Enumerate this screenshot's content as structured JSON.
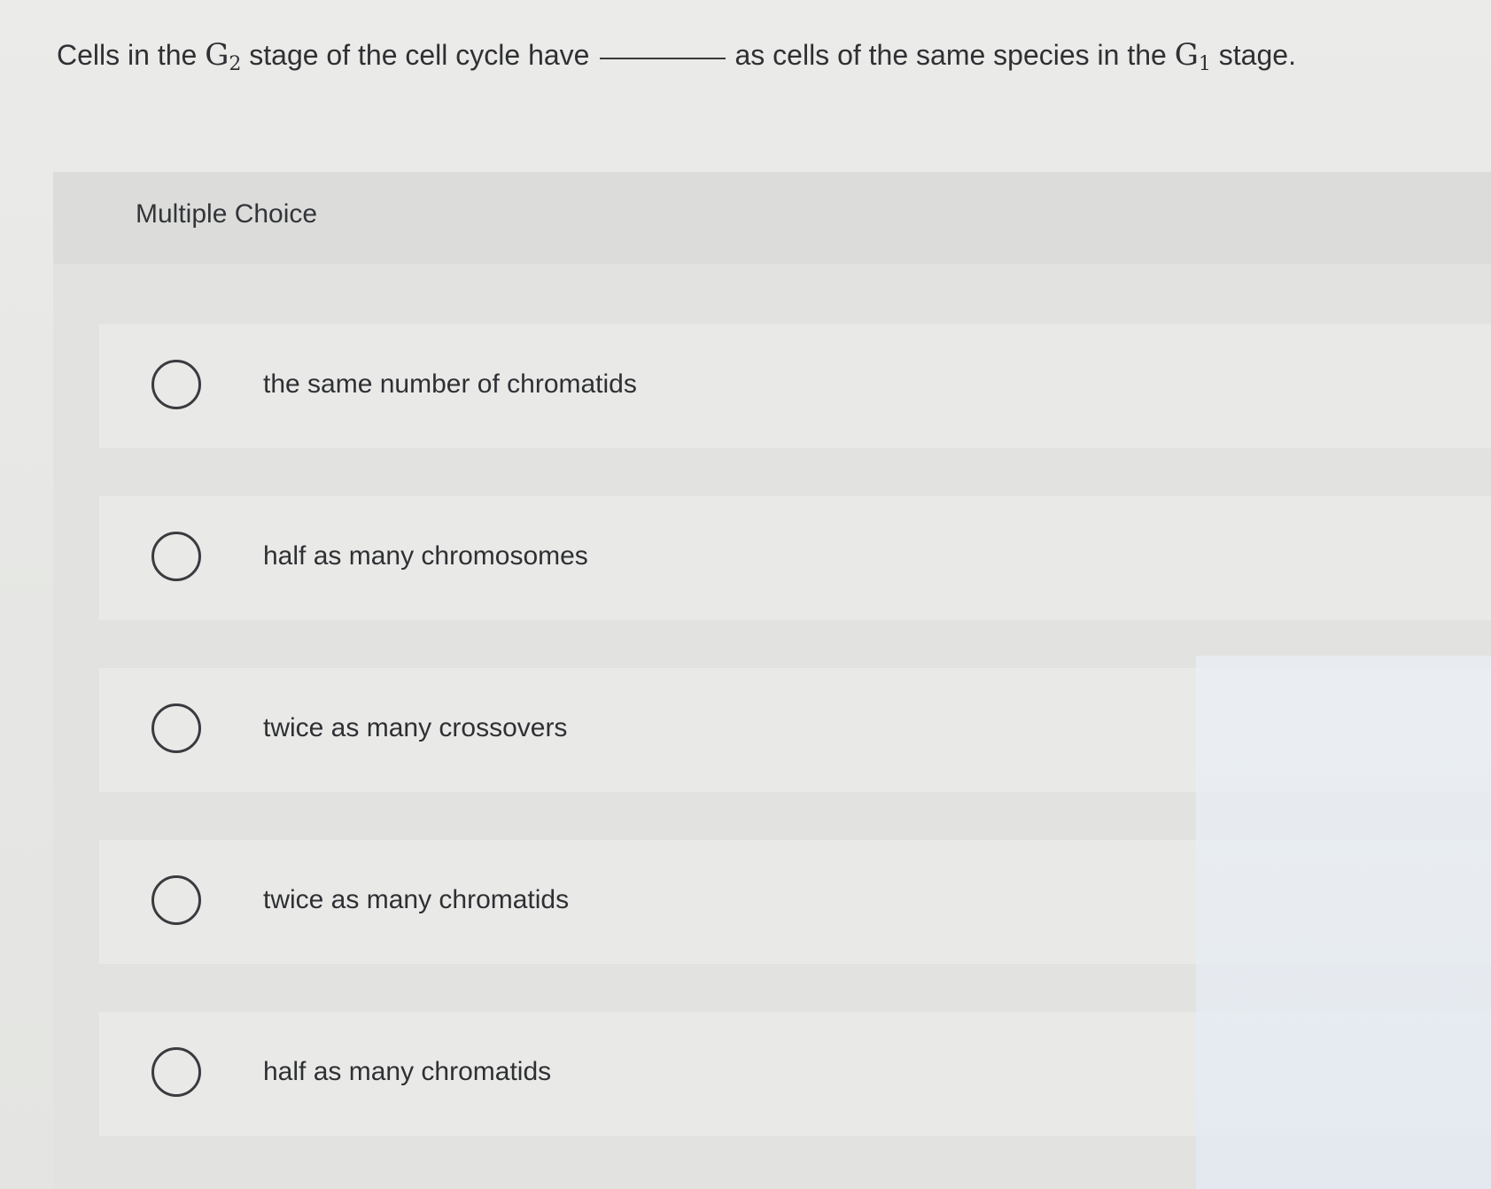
{
  "question": {
    "text_before": "Cells in the",
    "g2_base": "G",
    "g2_sub": "2",
    "text_middle": "stage of the cell cycle have",
    "text_after": "as cells of the same species in the",
    "g1_base": "G",
    "g1_sub": "1",
    "text_end": "stage."
  },
  "multiple_choice": {
    "title": "Multiple Choice",
    "options": [
      {
        "label": "the same number of chromatids",
        "selected": false
      },
      {
        "label": "half as many chromosomes",
        "selected": false
      },
      {
        "label": "twice as many crossovers",
        "selected": false
      },
      {
        "label": "twice as many chromatids",
        "selected": false
      },
      {
        "label": "half as many chromatids",
        "selected": false
      }
    ]
  }
}
